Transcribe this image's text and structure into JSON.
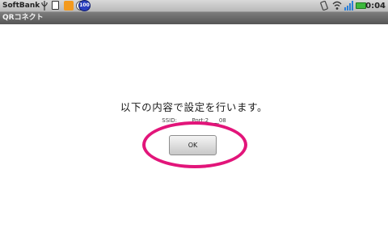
{
  "status_bar": {
    "carrier": "SoftBank",
    "notification_badge": "100",
    "time": "0:04",
    "left_icons": [
      "usb-icon",
      "sd-card-icon",
      "app-notification-icon",
      "sync-icon",
      "badge-100-icon"
    ],
    "right_icons": [
      "screen-rotate-icon",
      "wifi-icon",
      "signal-icon",
      "battery-icon"
    ]
  },
  "app": {
    "title": "QRコネクト"
  },
  "dialog": {
    "message": "以下の内容で設定を行います。",
    "ssid_text": "SSID: ____ Port:2 ___08",
    "ok_label": "OK"
  },
  "colors": {
    "highlight": "#e2157a",
    "battery": "#3db83d",
    "badge": "#2a3fbf"
  }
}
